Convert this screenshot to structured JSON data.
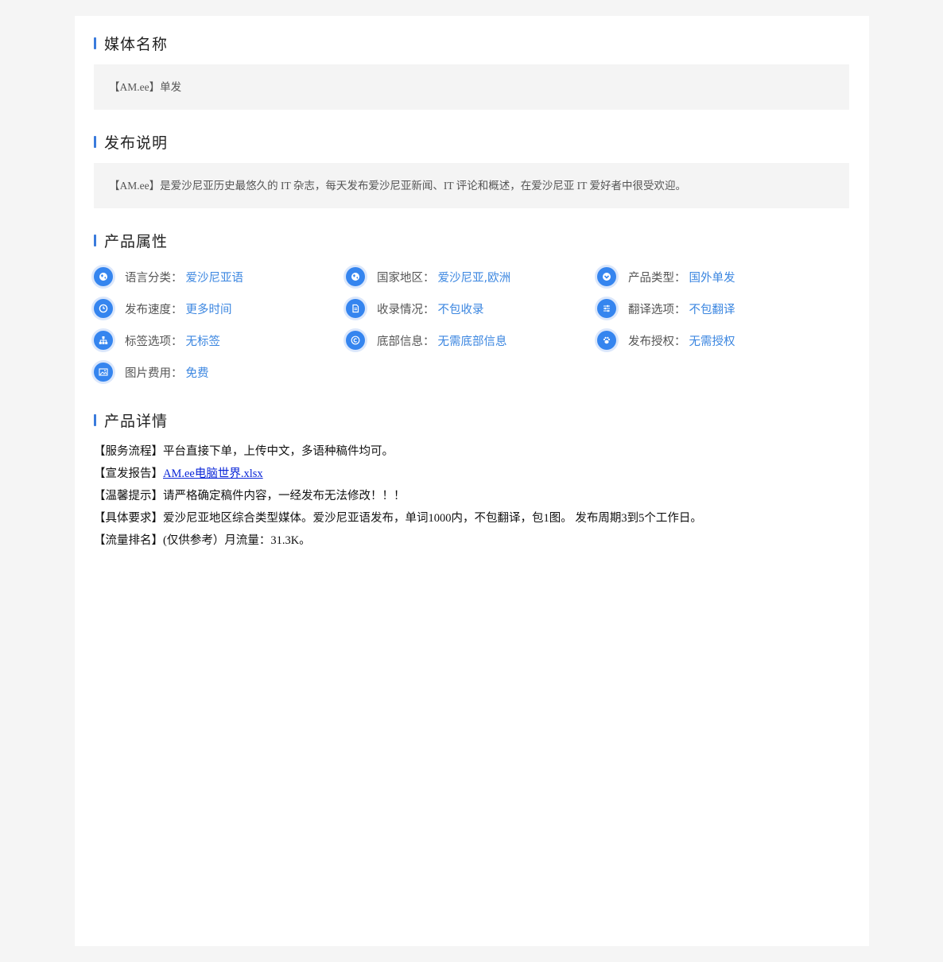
{
  "sections": {
    "media_name": {
      "title": "媒体名称",
      "content": "【AM.ee】单发"
    },
    "description": {
      "title": "发布说明",
      "content": "【AM.ee】是爱沙尼亚历史最悠久的 IT 杂志，每天发布爱沙尼亚新闻、IT 评论和概述，在爱沙尼亚 IT 爱好者中很受欢迎。"
    },
    "attributes": {
      "title": "产品属性",
      "items": [
        {
          "label": "语言分类：",
          "value": "爱沙尼亚语",
          "icon": "globe-icon"
        },
        {
          "label": "国家地区：",
          "value": "爱沙尼亚,欧洲",
          "icon": "globe-icon"
        },
        {
          "label": "产品类型：",
          "value": "国外单发",
          "icon": "chevron-down-icon"
        },
        {
          "label": "发布速度：",
          "value": "更多时间",
          "icon": "clock-icon"
        },
        {
          "label": "收录情况：",
          "value": "不包收录",
          "icon": "document-icon"
        },
        {
          "label": "翻译选项：",
          "value": "不包翻译",
          "icon": "sliders-icon"
        },
        {
          "label": "标签选项：",
          "value": "无标签",
          "icon": "sitemap-icon"
        },
        {
          "label": "底部信息：",
          "value": "无需底部信息",
          "icon": "copyright-icon"
        },
        {
          "label": "发布授权：",
          "value": "无需授权",
          "icon": "paw-icon"
        },
        {
          "label": "图片费用：",
          "value": "免费",
          "icon": "image-icon"
        }
      ]
    },
    "details": {
      "title": "产品详情",
      "lines": [
        {
          "prefix": "【服务流程】",
          "text": "平台直接下单，上传中文，多语种稿件均可。"
        },
        {
          "prefix": "【宣发报告】",
          "link": "AM.ee电脑世界.xlsx"
        },
        {
          "prefix": "【温馨提示】",
          "text": "请严格确定稿件内容，一经发布无法修改！！！"
        },
        {
          "prefix": "【具体要求】",
          "text": "爱沙尼亚地区综合类型媒体。爱沙尼亚语发布，单词1000内，不包翻译，包1图。 发布周期3到5个工作日。"
        },
        {
          "prefix": "【流量排名】",
          "text": "(仅供参考）月流量：31.3K。"
        }
      ]
    }
  },
  "colors": {
    "accent": "#3a7bdc",
    "icon_bg": "#3585ef",
    "value_text": "#3b86e0",
    "link": "#0a26d8",
    "page_bg": "#f5f5f5",
    "box_bg": "#f4f4f4"
  }
}
